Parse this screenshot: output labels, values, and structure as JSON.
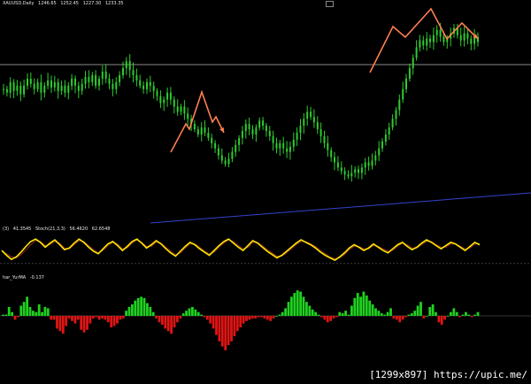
{
  "main_header": {
    "symbol": "XAUUSD,Daily",
    "ohlc": [
      "1246.65",
      "1252.45",
      "1227.30",
      "1233.35"
    ]
  },
  "stoch_header": {
    "label": "(3)",
    "values": [
      "41.3545",
      "Stoch(21,3,3)",
      "56.4620",
      "62.6548"
    ]
  },
  "hist_header": {
    "label": "har_YurMA",
    "value": "-0.137"
  },
  "watermark": "[1299x897] https://upic.me/",
  "colors": {
    "background": "#000000",
    "candle_up": "#2ecc2e",
    "price_line": "#8a8a8a",
    "trend_line": "#3344cc",
    "arrow": "#ff7f50",
    "stoch_main": "#ffe600",
    "stoch_signal": "#8b2a2a",
    "hist_up": "#1fd11f",
    "hist_down": "#e01414"
  },
  "chart_data": [
    {
      "type": "line",
      "title": "",
      "series": [
        {
          "values": [
            0.58,
            0.56,
            0.62,
            0.57,
            0.6,
            0.55,
            0.6,
            0.64,
            0.61,
            0.58,
            0.62,
            0.56,
            0.6,
            0.63,
            0.59,
            0.62,
            0.57,
            0.6,
            0.56,
            0.6,
            0.64,
            0.6,
            0.57,
            0.61,
            0.65,
            0.62,
            0.66,
            0.6,
            0.64,
            0.68,
            0.64,
            0.61,
            0.58,
            0.62,
            0.66,
            0.7,
            0.74,
            0.69,
            0.66,
            0.63,
            0.6,
            0.58,
            0.62,
            0.6,
            0.57,
            0.54,
            0.5,
            0.52,
            0.56,
            0.52,
            0.48,
            0.45,
            0.48,
            0.44,
            0.41,
            0.38,
            0.35,
            0.32,
            0.36,
            0.33,
            0.3,
            0.27,
            0.24,
            0.2,
            0.17,
            0.15,
            0.18,
            0.22,
            0.26,
            0.3,
            0.34,
            0.38,
            0.35,
            0.32,
            0.36,
            0.4,
            0.37,
            0.34,
            0.31,
            0.27,
            0.24,
            0.27,
            0.24,
            0.22,
            0.25,
            0.29,
            0.33,
            0.37,
            0.41,
            0.45,
            0.42,
            0.39,
            0.35,
            0.31,
            0.27,
            0.23,
            0.19,
            0.16,
            0.13,
            0.11,
            0.09,
            0.08,
            0.1,
            0.12,
            0.1,
            0.13,
            0.16,
            0.14,
            0.17,
            0.2,
            0.24,
            0.28,
            0.32,
            0.36,
            0.41,
            0.46,
            0.52,
            0.58,
            0.64,
            0.7,
            0.76,
            0.82,
            0.86,
            0.83,
            0.87,
            0.85,
            0.89,
            0.92,
            0.88,
            0.85,
            0.87,
            0.9,
            0.93,
            0.89,
            0.86,
            0.9,
            0.87,
            0.84,
            0.88,
            0.85
          ]
        }
      ]
    },
    {
      "type": "line",
      "title": "",
      "ylim": [
        0,
        100
      ],
      "series": [
        {
          "name": "Stoch(21,3,3)",
          "values": [
            52,
            40,
            30,
            36,
            48,
            62,
            74,
            80,
            72,
            60,
            70,
            78,
            66,
            54,
            58,
            70,
            80,
            72,
            60,
            50,
            44,
            56,
            68,
            74,
            64,
            52,
            62,
            74,
            80,
            70,
            58,
            66,
            76,
            68,
            56,
            46,
            38,
            50,
            62,
            72,
            66,
            56,
            48,
            40,
            52,
            64,
            74,
            80,
            70,
            60,
            52,
            64,
            76,
            70,
            60,
            50,
            42,
            34,
            40,
            50,
            60,
            70,
            78,
            72,
            66,
            58,
            48,
            40,
            34,
            28,
            36,
            46,
            58,
            66,
            60,
            52,
            58,
            68,
            60,
            52,
            46,
            56,
            66,
            72,
            62,
            54,
            60,
            70,
            78,
            72,
            64,
            56,
            64,
            72,
            68,
            60,
            52,
            62,
            72,
            66
          ]
        },
        {
          "name": "",
          "values": [
            50,
            44,
            36,
            34,
            42,
            54,
            66,
            76,
            74,
            64,
            66,
            74,
            70,
            58,
            56,
            66,
            76,
            74,
            64,
            54,
            46,
            52,
            64,
            72,
            68,
            56,
            58,
            70,
            78,
            72,
            62,
            62,
            72,
            70,
            60,
            50,
            42,
            46,
            58,
            68,
            68,
            60,
            50,
            44,
            48,
            60,
            70,
            78,
            74,
            64,
            56,
            60,
            72,
            72,
            64,
            54,
            46,
            38,
            38,
            46,
            56,
            66,
            74,
            74,
            68,
            62,
            52,
            44,
            36,
            32,
            34,
            42,
            54,
            62,
            62,
            56,
            56,
            64,
            62,
            56,
            50,
            52,
            62,
            70,
            66,
            58,
            58,
            66,
            74,
            74,
            66,
            60,
            60,
            68,
            68,
            62,
            56,
            58,
            68,
            68
          ]
        }
      ]
    },
    {
      "type": "bar",
      "title": "",
      "values": [
        2,
        2,
        14,
        6,
        -6,
        -2,
        16,
        22,
        30,
        14,
        8,
        6,
        18,
        6,
        14,
        12,
        -6,
        -6,
        -20,
        -24,
        -28,
        -16,
        -4,
        -8,
        -12,
        -6,
        -22,
        -26,
        -22,
        -12,
        -4,
        -2,
        -6,
        -4,
        -6,
        -10,
        -18,
        -16,
        -12,
        -6,
        -4,
        8,
        14,
        18,
        24,
        28,
        30,
        28,
        20,
        14,
        6,
        -4,
        -10,
        -14,
        -20,
        -24,
        -28,
        -18,
        -10,
        -4,
        4,
        8,
        12,
        14,
        10,
        6,
        2,
        -2,
        -6,
        -12,
        -20,
        -30,
        -40,
        -48,
        -54,
        -46,
        -40,
        -32,
        -24,
        -18,
        -12,
        -8,
        -6,
        -4,
        -4,
        -2,
        -2,
        -4,
        -6,
        -8,
        -4,
        0,
        2,
        6,
        12,
        22,
        30,
        36,
        40,
        38,
        30,
        22,
        16,
        10,
        6,
        2,
        -2,
        -6,
        -10,
        -8,
        -4,
        -2,
        6,
        4,
        8,
        2,
        16,
        28,
        36,
        30,
        38,
        32,
        24,
        18,
        12,
        8,
        4,
        2,
        6,
        12,
        -4,
        -6,
        -10,
        -6,
        -2,
        2,
        4,
        8,
        16,
        22,
        -4,
        0,
        14,
        18,
        6,
        -10,
        -14,
        -6,
        0,
        6,
        12,
        6,
        -2,
        2,
        6,
        2,
        -2,
        2,
        6
      ]
    }
  ]
}
